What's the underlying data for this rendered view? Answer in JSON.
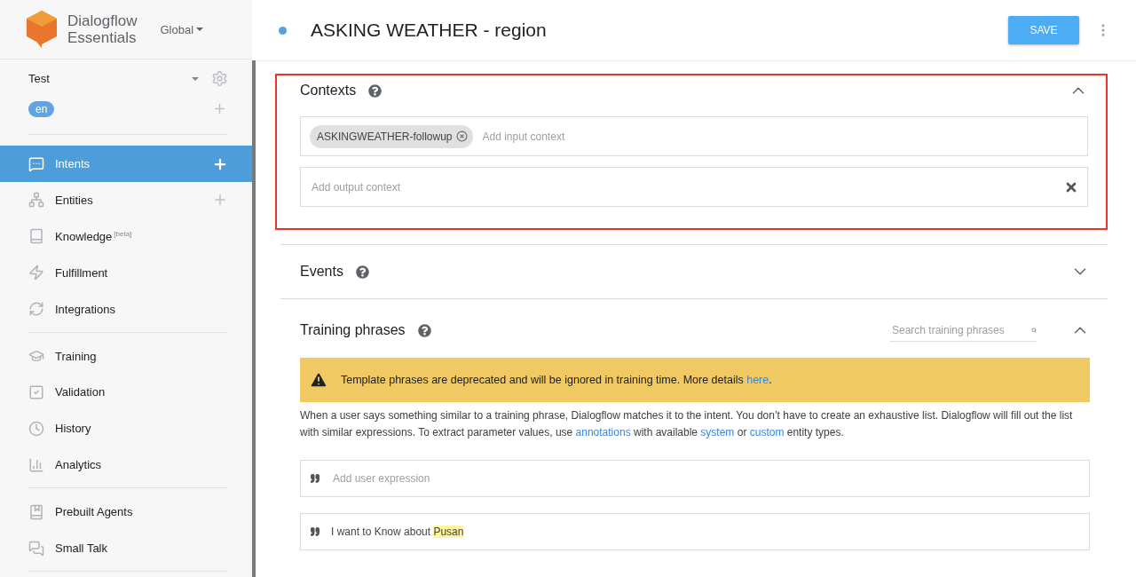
{
  "brand": {
    "line1": "Dialogflow",
    "line2": "Essentials",
    "region": "Global"
  },
  "agent": {
    "name": "Test",
    "language": "en"
  },
  "nav_groups": [
    {
      "items": [
        {
          "kind": "intents",
          "label": "Intents",
          "selected": true,
          "addable": true
        },
        {
          "kind": "entities",
          "label": "Entities",
          "selected": false,
          "addable": true
        },
        {
          "kind": "knowledge",
          "label": "Knowledge",
          "sup": "[beta]",
          "selected": false,
          "addable": false
        },
        {
          "kind": "fulfillment",
          "label": "Fulfillment",
          "selected": false,
          "addable": false
        },
        {
          "kind": "integrations",
          "label": "Integrations",
          "selected": false,
          "addable": false
        }
      ]
    },
    {
      "items": [
        {
          "kind": "training",
          "label": "Training",
          "selected": false,
          "addable": false
        },
        {
          "kind": "validation",
          "label": "Validation",
          "selected": false,
          "addable": false
        },
        {
          "kind": "history",
          "label": "History",
          "selected": false,
          "addable": false
        },
        {
          "kind": "analytics",
          "label": "Analytics",
          "selected": false,
          "addable": false
        }
      ]
    },
    {
      "items": [
        {
          "kind": "prebuilt",
          "label": "Prebuilt Agents",
          "selected": false,
          "addable": false
        },
        {
          "kind": "smalltalk",
          "label": "Small Talk",
          "selected": false,
          "addable": false
        }
      ]
    }
  ],
  "header": {
    "title": "ASKING WEATHER - region",
    "save": "SAVE"
  },
  "contexts": {
    "title": "Contexts",
    "expanded": true,
    "highlighted": true,
    "input_chips": [
      "ASKINGWEATHER-followup"
    ],
    "input_placeholder": "Add input context",
    "output_placeholder": "Add output context"
  },
  "events": {
    "title": "Events",
    "expanded": false
  },
  "training": {
    "title": "Training phrases",
    "expanded": true,
    "search_placeholder": "Search training phrases",
    "warning": [
      {
        "text": "Template phrases are deprecated and will be ignored in training time. More details ",
        "link": false
      },
      {
        "text": "here",
        "link": true
      },
      {
        "text": ".",
        "link": false
      }
    ],
    "description": [
      {
        "text": "When a user says something similar to a training phrase, Dialogflow matches it to the intent. You don’t have to create an exhaustive list. Dialogflow will fill out the list with similar expressions. To extract parameter values, use ",
        "link": false
      },
      {
        "text": "annotations",
        "link": true
      },
      {
        "text": " with available ",
        "link": false
      },
      {
        "text": "system",
        "link": true
      },
      {
        "text": " or ",
        "link": false
      },
      {
        "text": "custom",
        "link": true
      },
      {
        "text": " entity types.",
        "link": false
      }
    ],
    "add_placeholder": "Add user expression",
    "phrases": [
      {
        "parts": [
          {
            "text": "I want to Know about ",
            "annotated": false
          },
          {
            "text": "Pusan",
            "annotated": true
          }
        ]
      }
    ]
  }
}
